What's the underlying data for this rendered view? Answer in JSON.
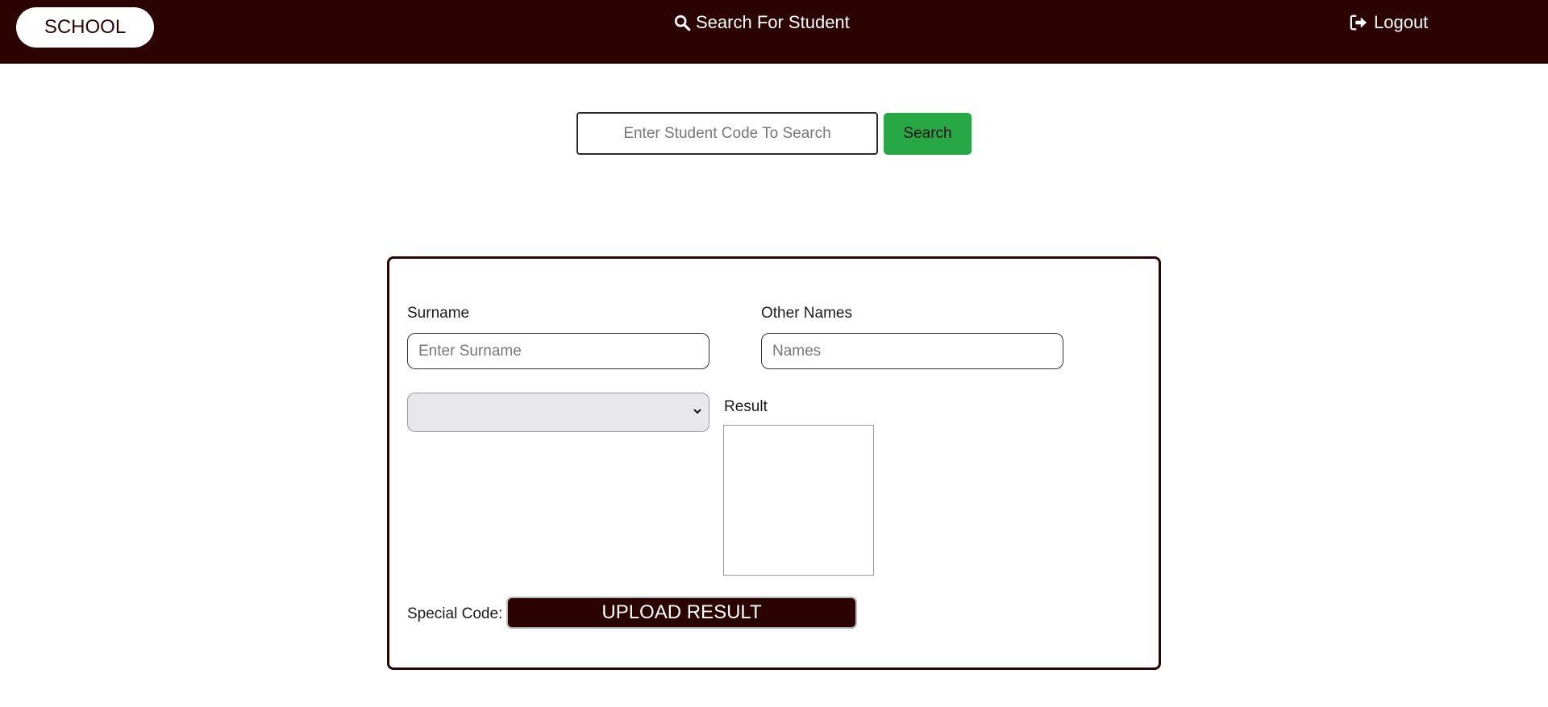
{
  "navbar": {
    "brand": "SCHOOL",
    "search_link": "Search For Student",
    "search_icon": "search-icon",
    "logout_link": "Logout",
    "logout_icon": "sign-out-icon",
    "background_color": "#2b0300"
  },
  "search": {
    "placeholder": "Enter Student Code To Search",
    "value": "",
    "button_label": "Search",
    "button_color": "#28a745"
  },
  "form": {
    "surname_label": "Surname",
    "surname_placeholder": "Enter Surname",
    "other_names_label": "Other Names",
    "other_names_placeholder": "Names",
    "select_value": "",
    "result_label": "Result",
    "special_code_label": "Special Code:",
    "upload_button_label": "UPLOAD RESULT"
  }
}
